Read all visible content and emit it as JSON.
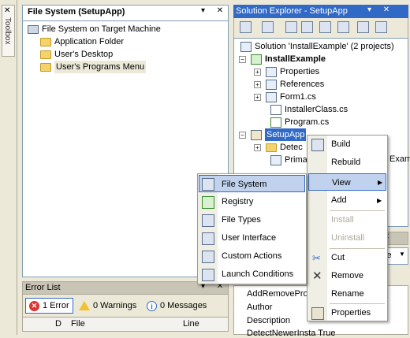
{
  "toolbox": {
    "label": "Toolbox"
  },
  "file_system": {
    "tab_title": "File System (SetupApp)",
    "ctrls": "▾ ✕",
    "root": "File System on Target Machine",
    "folders": [
      "Application Folder",
      "User's Desktop",
      "User's Programs Menu"
    ]
  },
  "error_list": {
    "title": "Error List",
    "ctrls": "▾ ✕",
    "errors": "1 Error",
    "warnings": "0 Warnings",
    "messages": "0 Messages",
    "columns": [
      "D",
      "File",
      "Line"
    ]
  },
  "solution_explorer": {
    "title": "Solution Explorer - SetupApp",
    "ctrls": "▾ ✕",
    "solution": "Solution 'InstallExample' (2 projects)",
    "project": "InstallExample",
    "items": [
      "Properties",
      "References",
      "Form1.cs",
      "InstallerClass.cs",
      "Program.cs"
    ],
    "setup_project": "SetupApp",
    "setup_items": [
      "Detec",
      "Prima"
    ],
    "partial_right": "Exam"
  },
  "properties": {
    "ctrls": "▾ ✕",
    "combo_tail": "ie",
    "rows": [
      "AddRemoveProc",
      "Author",
      "Description",
      "DetectNewerInsta True"
    ]
  },
  "context_menu": {
    "items": [
      {
        "label": "Build",
        "state": "normal"
      },
      {
        "label": "Rebuild",
        "state": "normal"
      },
      {
        "label": "View",
        "state": "highlighted",
        "submenu": true
      },
      {
        "label": "Add",
        "state": "normal",
        "submenu": true
      },
      {
        "label": "Install",
        "state": "disabled"
      },
      {
        "label": "Uninstall",
        "state": "disabled"
      },
      {
        "label": "Cut",
        "state": "normal"
      },
      {
        "label": "Remove",
        "state": "normal"
      },
      {
        "label": "Rename",
        "state": "normal"
      },
      {
        "label": "Properties",
        "state": "normal"
      }
    ]
  },
  "view_submenu": {
    "items": [
      "File System",
      "Registry",
      "File Types",
      "User Interface",
      "Custom Actions",
      "Launch Conditions"
    ]
  },
  "colors": {
    "title_active": "#3169c6",
    "highlight": "#c1d2ee",
    "highlight_border": "#316ac5"
  }
}
